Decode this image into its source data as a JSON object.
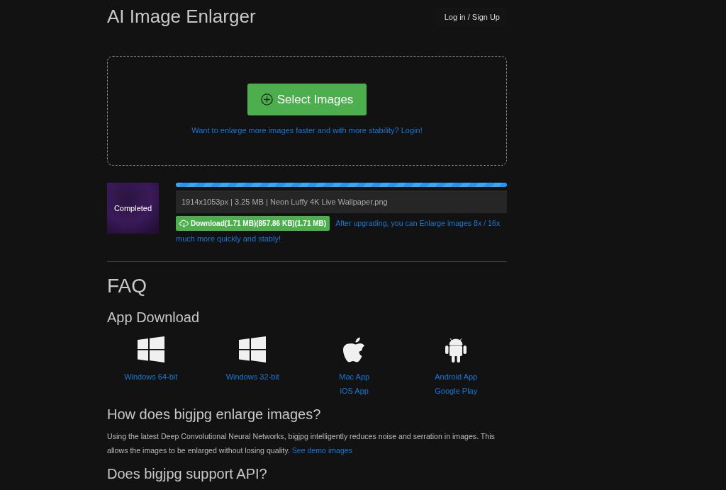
{
  "header": {
    "title": "AI Image Enlarger",
    "login_button": "Log in / Sign Up"
  },
  "upload": {
    "button": "Select Images",
    "login_link": "Want to enlarge more images faster and with more stability? Login!"
  },
  "file": {
    "thumbnail_label": "Completed",
    "level": 1,
    "info": "1914x1053px | 3.25 MB | Neon Luffy 4K Live Wallpaper.png",
    "download_button": "Download(1.71 MB)(857.86 KB)(1.71 MB)",
    "upgrade_link": [
      "After upgrading, you can Enlarge images 8x / 16x",
      "much more quickly and stably!"
    ]
  },
  "faq": {
    "title": "FAQ",
    "app_download": {
      "title": "App Download",
      "apps": [
        {
          "kind": "windows",
          "links": [
            "Windows 64-bit"
          ]
        },
        {
          "kind": "windows",
          "links": [
            "Windows 32-bit"
          ]
        },
        {
          "kind": "apple",
          "links": [
            "Mac App",
            "iOS App"
          ]
        },
        {
          "kind": "android",
          "links": [
            "Android App",
            "Google Play"
          ]
        }
      ]
    },
    "questions": [
      {
        "title": "How does bigjpg enlarge images?",
        "text": "Using the latest Deep Convolutional Neural Networks, bigjpg intelligently reduces noise and serration in images. This allows the images to be enlarged without losing quality.",
        "link": "See demo images"
      },
      {
        "title": "Does bigjpg support API?"
      }
    ]
  }
}
